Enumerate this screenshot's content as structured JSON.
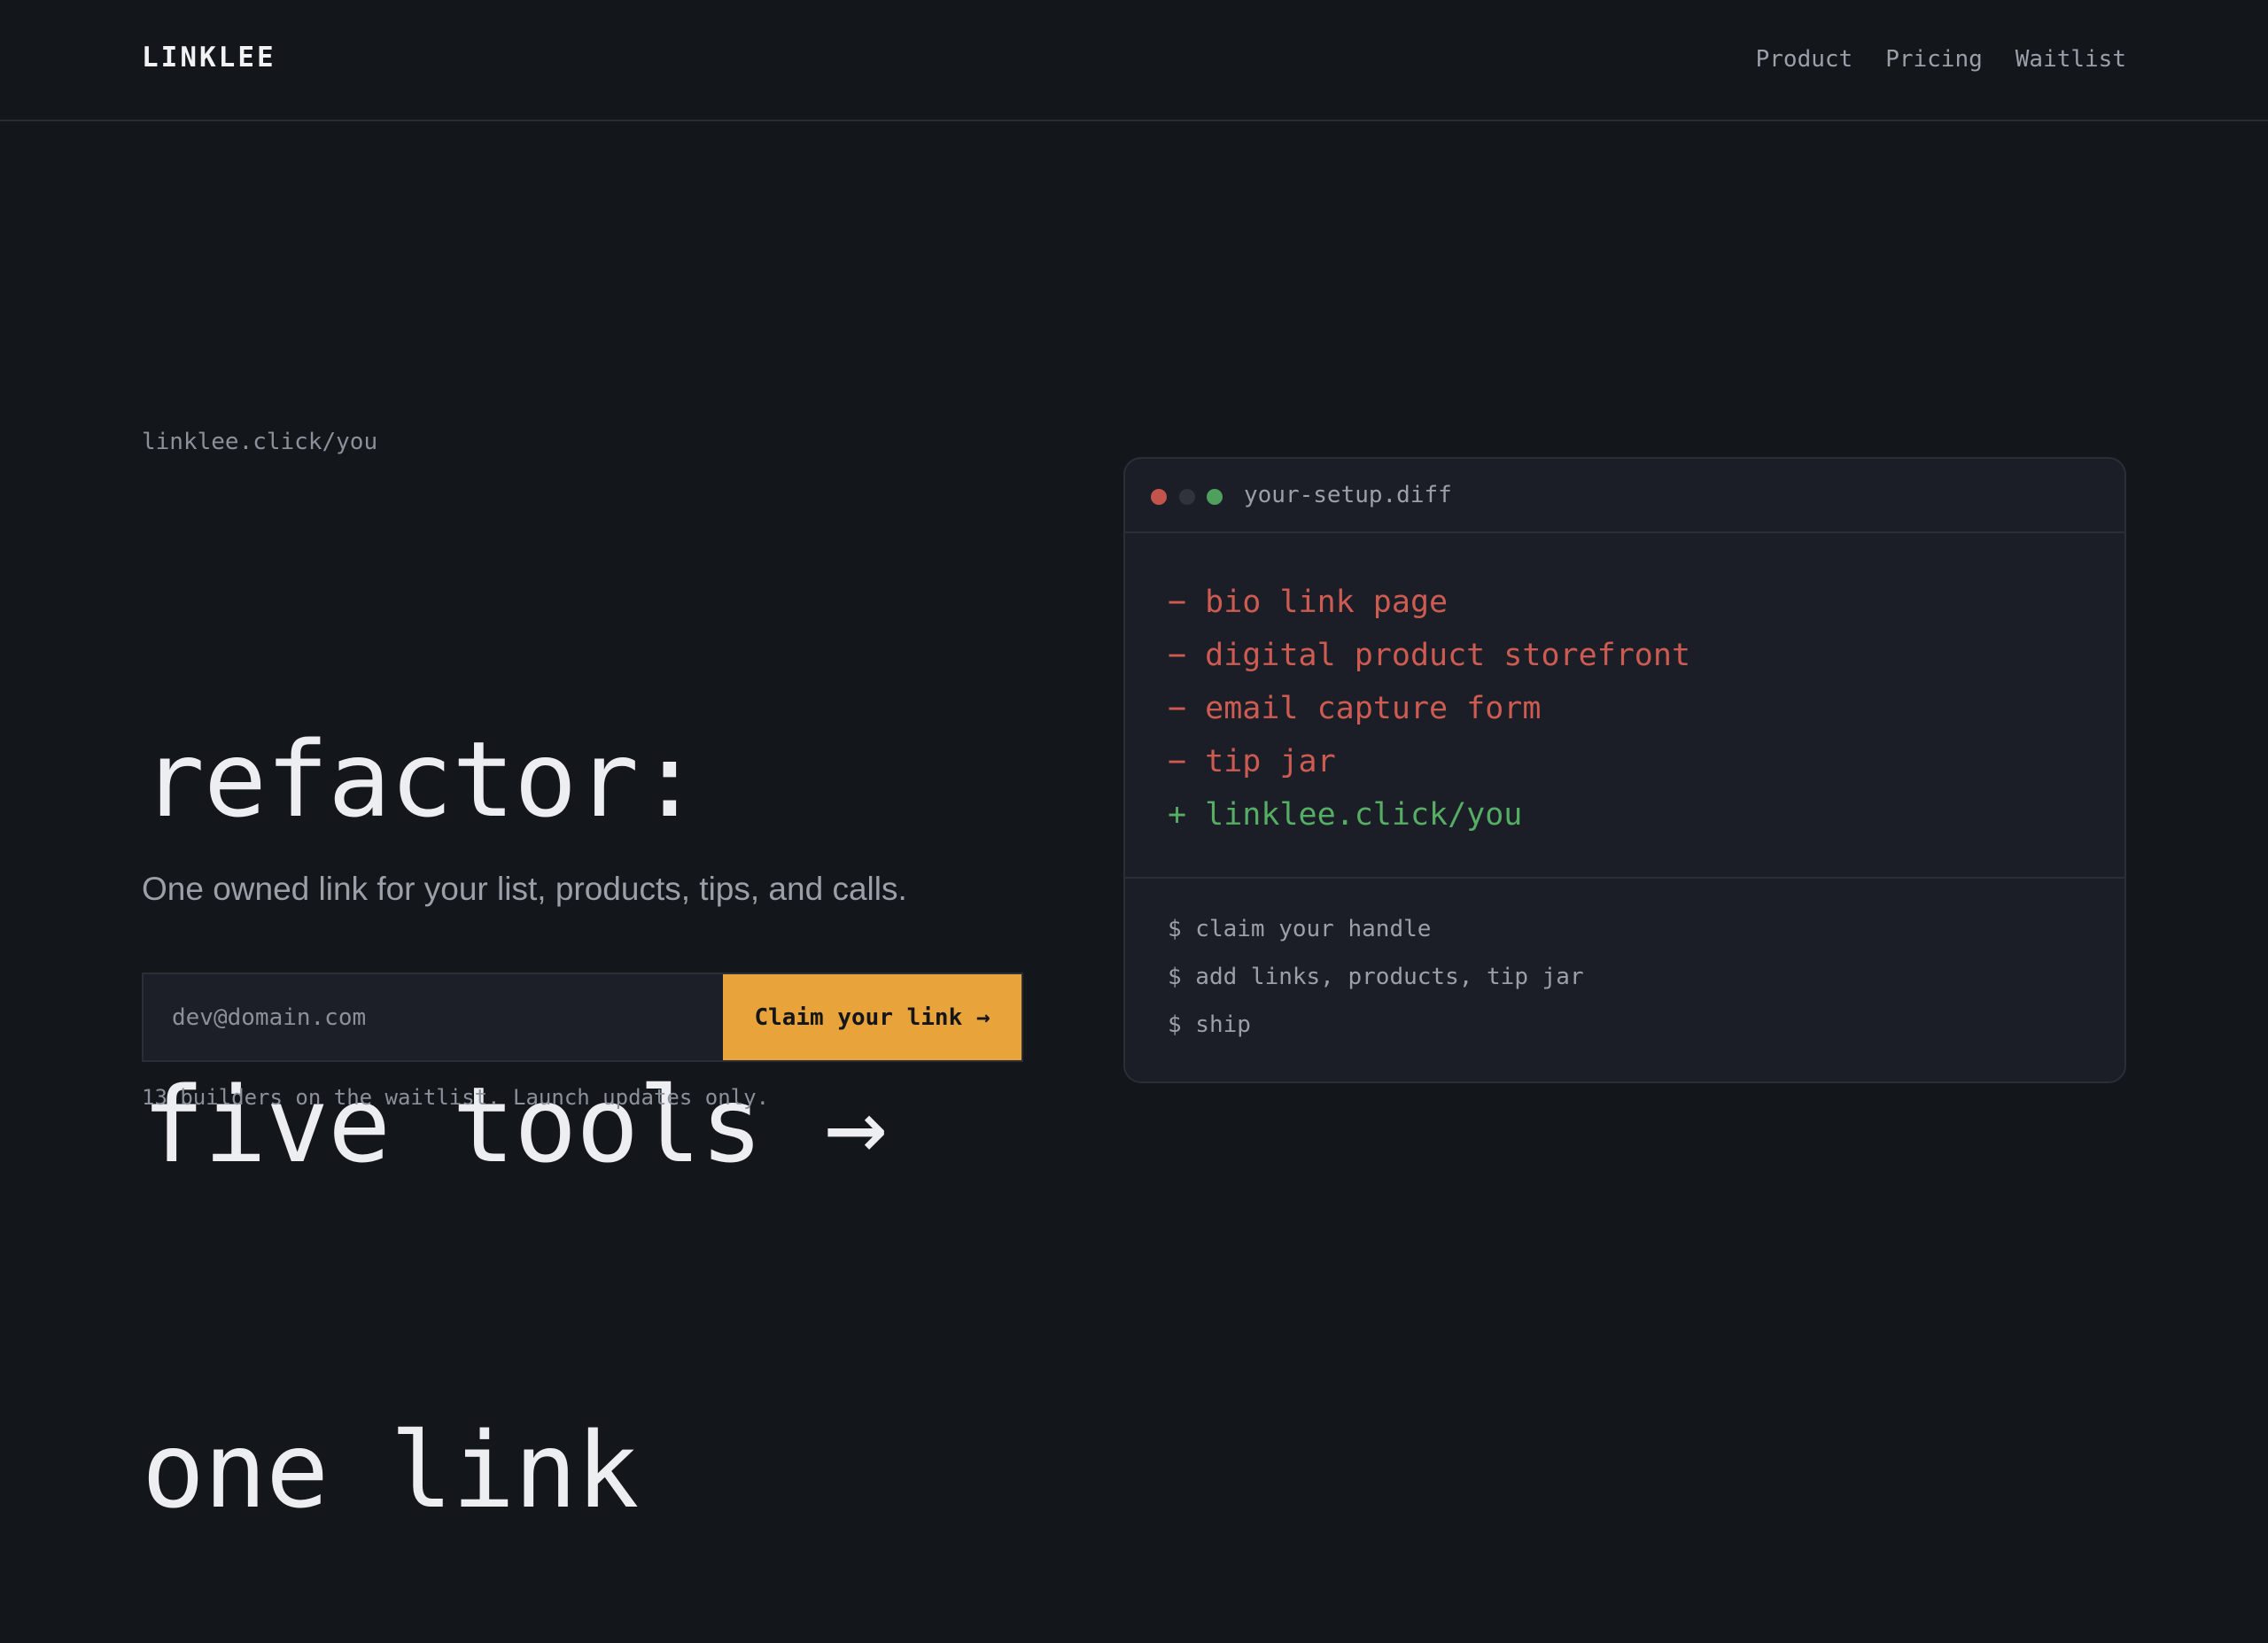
{
  "header": {
    "logo": "LINKLEE",
    "nav": [
      "Product",
      "Pricing",
      "Waitlist"
    ]
  },
  "hero": {
    "handle_label": "linklee.click/you",
    "headline_lines": [
      "refactor:",
      "five tools →",
      "one link"
    ],
    "subhead": "One owned link for your list, products, tips, and calls.",
    "email_placeholder": "dev@domain.com",
    "claim_button": "Claim your link →",
    "waitlist_note": "13 builders on the waitlist. Launch updates only."
  },
  "panel": {
    "filename": "your-setup.diff",
    "diff": [
      {
        "sign": "−",
        "text": "bio link page",
        "kind": "removed"
      },
      {
        "sign": "−",
        "text": "digital product storefront",
        "kind": "removed"
      },
      {
        "sign": "−",
        "text": "email capture form",
        "kind": "removed"
      },
      {
        "sign": "−",
        "text": "tip jar",
        "kind": "removed"
      },
      {
        "sign": "+",
        "text": "linklee.click/you",
        "kind": "added"
      }
    ],
    "commands": [
      "$ claim your handle",
      "$ add links, products, tip jar",
      "$ ship"
    ]
  },
  "colors": {
    "background": "#13161b",
    "accent": "#e8a33b",
    "removed": "#cd5b52",
    "added": "#56ae64"
  }
}
